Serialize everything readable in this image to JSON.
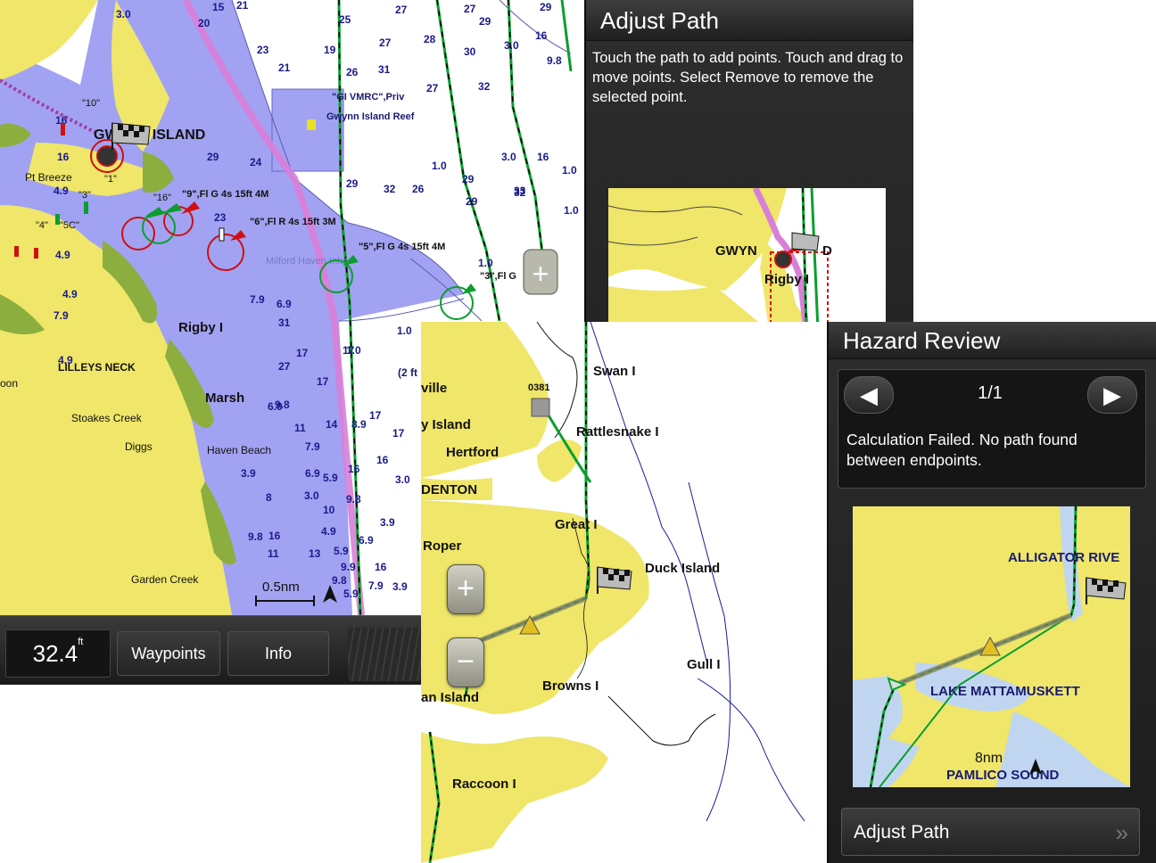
{
  "screen1": {
    "depth_value": "32.4",
    "depth_unit": "ft",
    "buttons": {
      "waypoints": "Waypoints",
      "info": "Info"
    },
    "scale": "0.5nm",
    "map_labels": {
      "gwynn_island": "GWYNN ISLAND",
      "pt_breeze": "Pt Breeze",
      "rigby": "Rigby I",
      "lilleys_neck": "LILLEYS NECK",
      "marsh": "Marsh",
      "stoakes_creek": "Stoakes Creek",
      "diggs": "Diggs",
      "haven_beach": "Haven Beach",
      "garden_creek": "Garden Creek",
      "milford": "Milford Haven Inlet",
      "gwynn_reef": "Gwynn Island Reef",
      "vmrc": "\"GI VMRC\",Priv",
      "b10": "\"10\"",
      "b1": "\"1\"",
      "b3": "\"3\"",
      "b16": "\"16\"",
      "b4": "\"4\"",
      "b5c": "\"5C\"",
      "b9": "\"9\",Fl G 4s 15ft 4M",
      "b6": "\"6\",Fl R 4s 15ft 3M",
      "b5": "\"5\",Fl G 4s 15ft 4M",
      "b3b": "\"3\",Fl G",
      "oon": "oon",
      "twoft": "(2 ft"
    },
    "soundings": [
      "3.0",
      "15",
      "21",
      "27",
      "25",
      "27",
      "29",
      "29",
      "23",
      "19",
      "27",
      "28",
      "30",
      "21",
      "20",
      "26",
      "31",
      "27",
      "32",
      "9.8",
      "3.0",
      "16",
      "16",
      "29",
      "24",
      "29",
      "32",
      "1.0",
      "3.0",
      "16",
      "16",
      "23",
      "26",
      "29",
      "33",
      "1.0",
      "4.9",
      "6.9",
      "31",
      "29",
      "32",
      "1.0",
      "4.9",
      "7.9",
      "27",
      "1.0",
      "4.9",
      "6.9",
      "17",
      "1.0",
      "7.9",
      "6.9",
      "17",
      "1.0",
      "4.9",
      "9.8",
      "17",
      "8.9",
      "11",
      "14",
      "17",
      "17",
      "7.9",
      "5.9",
      "16",
      "16",
      "3.0",
      "9.8",
      "3.9",
      "9.8",
      "10",
      "9.9",
      "16",
      "7.9",
      "3.9",
      "11",
      "13",
      "8",
      "5.9",
      "6.9",
      "5.9",
      "3.0",
      "9.8",
      "4.9",
      "3.9",
      "16"
    ],
    "adjust_panel": {
      "title": "Adjust Path",
      "description": "Touch the path to add points. Touch and drag to move points. Select Remove to remove the selected point.",
      "preview_labels": {
        "gwynn": "GWYN",
        "rigby": "Rigby I",
        "d": "D"
      }
    }
  },
  "screen2": {
    "map_labels": {
      "swan": "Swan I",
      "ville": "ville",
      "island": "y Island",
      "rattlesnake": "Rattlesnake I",
      "hertford": "Hertford",
      "edenton": "DENTON",
      "great": "Great I",
      "roper": "Roper",
      "duck": "Duck Island",
      "gull": "Gull I",
      "browns": "Browns I",
      "an_island": "an Island",
      "raccoon": "Raccoon I",
      "marker": "0381"
    },
    "zoom_in": "+",
    "zoom_out": "−",
    "hazard_panel": {
      "title": "Hazard Review",
      "counter": "1/1",
      "prev": "◀",
      "next": "▶",
      "message": "Calculation Failed. No path found between endpoints.",
      "preview_labels": {
        "alligator": "ALLIGATOR RIVE",
        "lake": "LAKE MATTAMUSKETT",
        "pamlico": "PAMLICO SOUND"
      },
      "preview_scale": "8nm",
      "button": "Adjust Path",
      "button_chevron": "»"
    }
  },
  "colors": {
    "land": "#efe66a",
    "shallow": "#a2a2f2",
    "deep": "#ffffff",
    "marsh": "#8cae3e",
    "route": "#0b9e2f",
    "path": "#d880d8",
    "panel": "#262626"
  }
}
